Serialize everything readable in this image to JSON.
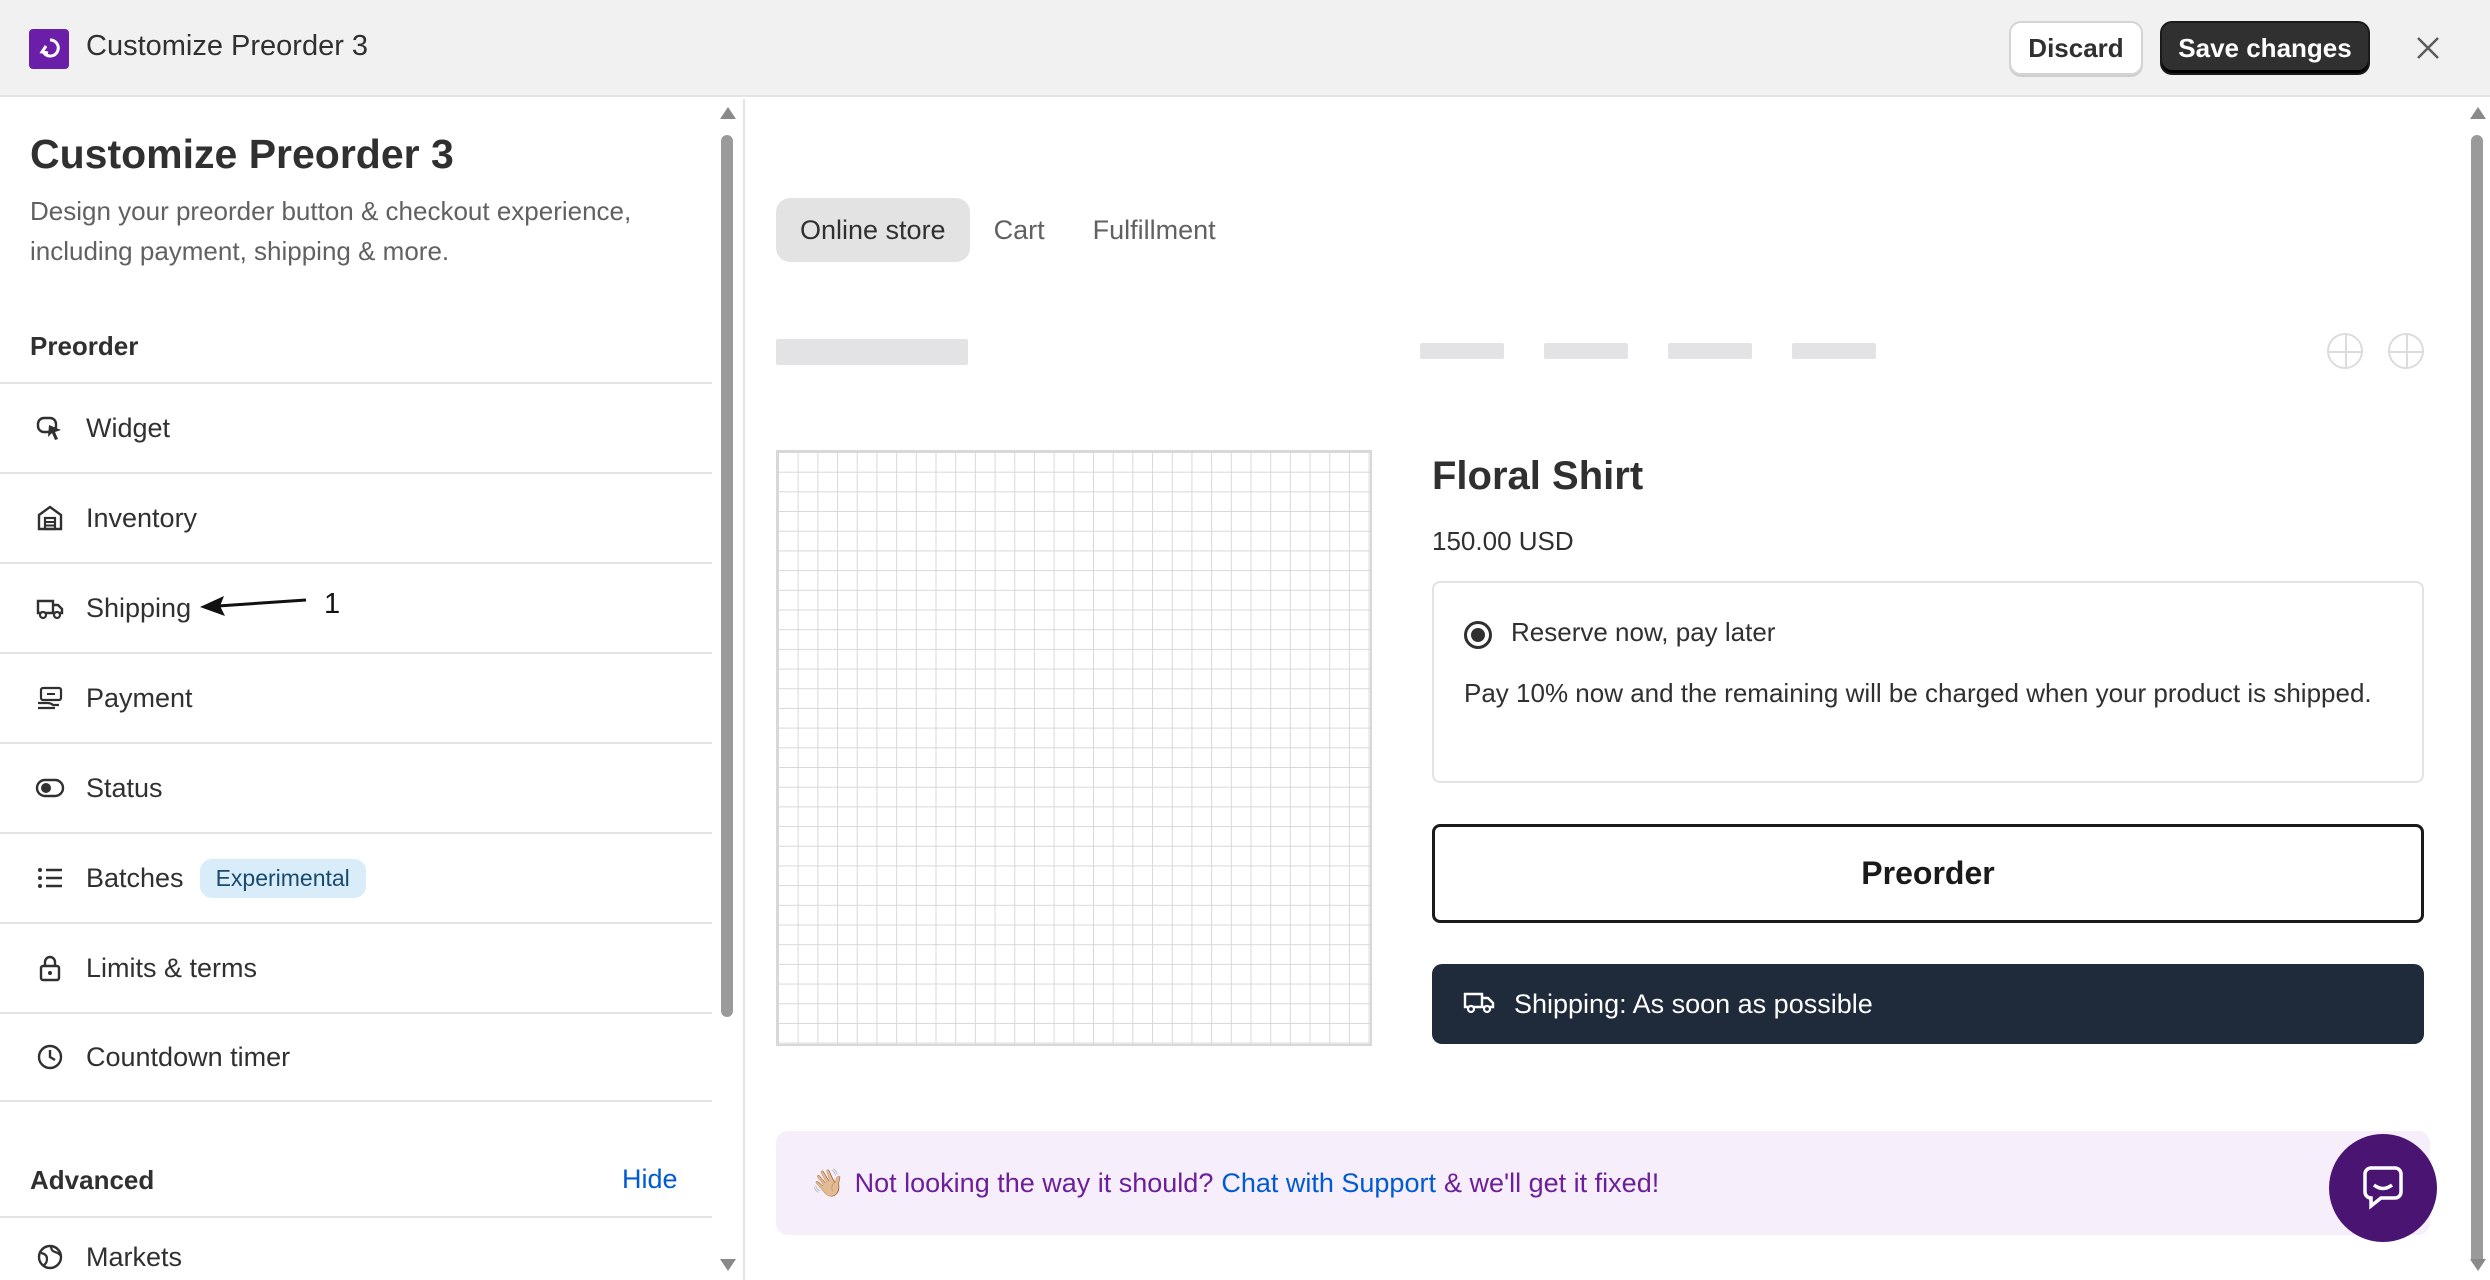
{
  "topbar": {
    "title": "Customize Preorder 3",
    "discard_label": "Discard",
    "save_label": "Save changes"
  },
  "sidebar": {
    "title": "Customize Preorder 3",
    "description": "Design your preorder button & checkout experience, including payment, shipping & more.",
    "section_preorder": "Preorder",
    "items": [
      {
        "label": "Widget",
        "icon": "cursor-click-icon"
      },
      {
        "label": "Inventory",
        "icon": "warehouse-icon"
      },
      {
        "label": "Shipping",
        "icon": "truck-icon"
      },
      {
        "label": "Payment",
        "icon": "cash-hand-icon"
      },
      {
        "label": "Status",
        "icon": "toggle-icon"
      },
      {
        "label": "Batches",
        "icon": "list-icon",
        "badge": "Experimental"
      },
      {
        "label": "Limits & terms",
        "icon": "lock-icon"
      },
      {
        "label": "Countdown timer",
        "icon": "clock-icon"
      }
    ],
    "section_advanced": "Advanced",
    "hide_label": "Hide",
    "markets_label": "Markets",
    "annotation_number": "1"
  },
  "preview": {
    "tabs": [
      "Online store",
      "Cart",
      "Fulfillment"
    ],
    "active_tab": "Online store",
    "product_title": "Floral Shirt",
    "product_price": "150.00 USD",
    "payment_option": "Reserve now, pay later",
    "payment_description": "Pay 10% now and the remaining will be charged when your product is shipped.",
    "preorder_button": "Preorder",
    "shipping_text": "Shipping: As soon as possible"
  },
  "support": {
    "emoji": "👋🏼",
    "text_before": "Not looking the way it should?",
    "link": "Chat with Support",
    "text_after": "& we'll get it fixed!"
  },
  "colors": {
    "brand": "#6b1fa8",
    "accent_link": "#005bd3",
    "shipping_bar": "#1f2a3a",
    "support_bg": "#f6eefb"
  }
}
